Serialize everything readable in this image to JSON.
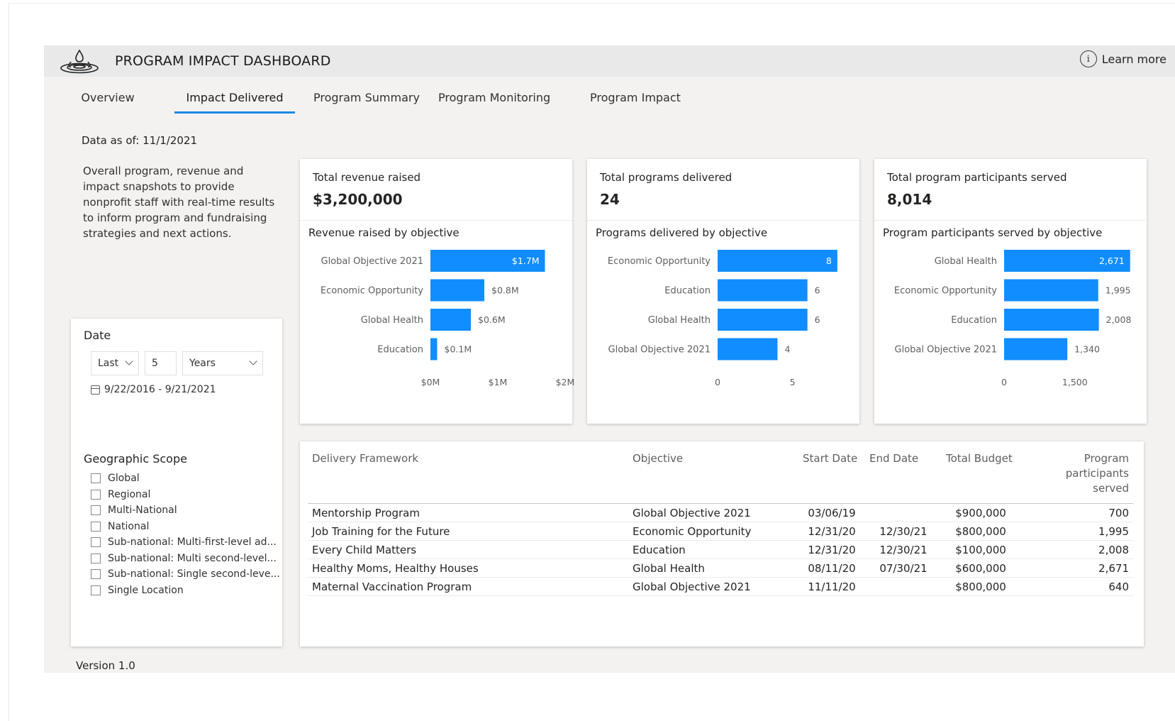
{
  "header": {
    "title": "PROGRAM IMPACT DASHBOARD",
    "learn_more": "Learn more",
    "info_glyph": "i"
  },
  "tabs": [
    {
      "label": "Overview"
    },
    {
      "label": "Impact Delivered",
      "active": true
    },
    {
      "label": "Program Summary"
    },
    {
      "label": "Program Monitoring"
    },
    {
      "label": "Program Impact"
    }
  ],
  "data_as_of": "Data as of:  11/1/2021",
  "intro": "Overall program, revenue and impact snapshots to provide nonprofit staff with real-time results to inform program and fundraising strategies and next actions.",
  "date_filter": {
    "label": "Date",
    "relative": "Last",
    "count": "5",
    "unit": "Years",
    "range": "9/22/2016 - 9/21/2021"
  },
  "geo_filter": {
    "label": "Geographic Scope",
    "options": [
      "Global",
      "Regional",
      "Multi-National",
      "National",
      "Sub-national: Multi-first-level ad...",
      "Sub-national: Multi second-level...",
      "Sub-national: Single second-leve...",
      "Single Location"
    ]
  },
  "kpis": [
    {
      "title": "Total revenue raised",
      "value": "$3,200,000"
    },
    {
      "title": "Total programs delivered",
      "value": "24"
    },
    {
      "title": "Total program participants served",
      "value": "8,014"
    }
  ],
  "chart_data": [
    {
      "type": "bar",
      "orientation": "horizontal",
      "title": "Revenue raised by objective",
      "categories": [
        "Global Objective 2021",
        "Economic Opportunity",
        "Global Health",
        "Education"
      ],
      "values": [
        1.7,
        0.8,
        0.6,
        0.1
      ],
      "data_labels": [
        "$1.7M",
        "$0.8M",
        "$0.6M",
        "$0.1M"
      ],
      "xlim": [
        0,
        2
      ],
      "ticks": [
        0,
        1,
        2
      ],
      "tick_labels": [
        "$0M",
        "$1M",
        "$2M"
      ],
      "color": "#118dff",
      "grid": false
    },
    {
      "type": "bar",
      "orientation": "horizontal",
      "title": "Programs delivered by objective",
      "categories": [
        "Economic Opportunity",
        "Education",
        "Global Health",
        "Global Objective 2021"
      ],
      "values": [
        8,
        6,
        6,
        4
      ],
      "data_labels": [
        "8",
        "6",
        "6",
        "4"
      ],
      "xlim": [
        0,
        9
      ],
      "ticks": [
        0,
        5
      ],
      "tick_labels": [
        "0",
        "5"
      ],
      "color": "#118dff",
      "grid": false
    },
    {
      "type": "bar",
      "orientation": "horizontal",
      "title": "Program participants served by objective",
      "categories": [
        "Global Health",
        "Economic Opportunity",
        "Education",
        "Global Objective 2021"
      ],
      "values": [
        2671,
        1995,
        2008,
        1340
      ],
      "data_labels": [
        "2,671",
        "1,995",
        "2,008",
        "1,340"
      ],
      "xlim": [
        0,
        2900
      ],
      "ticks": [
        0,
        1500
      ],
      "tick_labels": [
        "0",
        "1,500"
      ],
      "color": "#118dff",
      "grid": false
    }
  ],
  "table": {
    "columns": [
      "Delivery Framework",
      "Objective",
      "Start Date",
      "End Date",
      "Total Budget",
      "Program participants served"
    ],
    "rows": [
      [
        "Mentorship Program",
        "Global Objective 2021",
        "03/06/19",
        "",
        "$900,000",
        "700"
      ],
      [
        "Job Training for the Future",
        "Economic Opportunity",
        "12/31/20",
        "12/30/21",
        "$800,000",
        "1,995"
      ],
      [
        "Every Child Matters",
        "Education",
        "12/31/20",
        "12/30/21",
        "$100,000",
        "2,008"
      ],
      [
        "Healthy Moms, Healthy Houses",
        "Global Health",
        "08/11/20",
        "07/30/21",
        "$600,000",
        "2,671"
      ],
      [
        "Maternal Vaccination Program",
        "Global Objective 2021",
        "11/11/20",
        "",
        "$800,000",
        "640"
      ]
    ]
  },
  "footer": {
    "version": "Version 1.0"
  }
}
